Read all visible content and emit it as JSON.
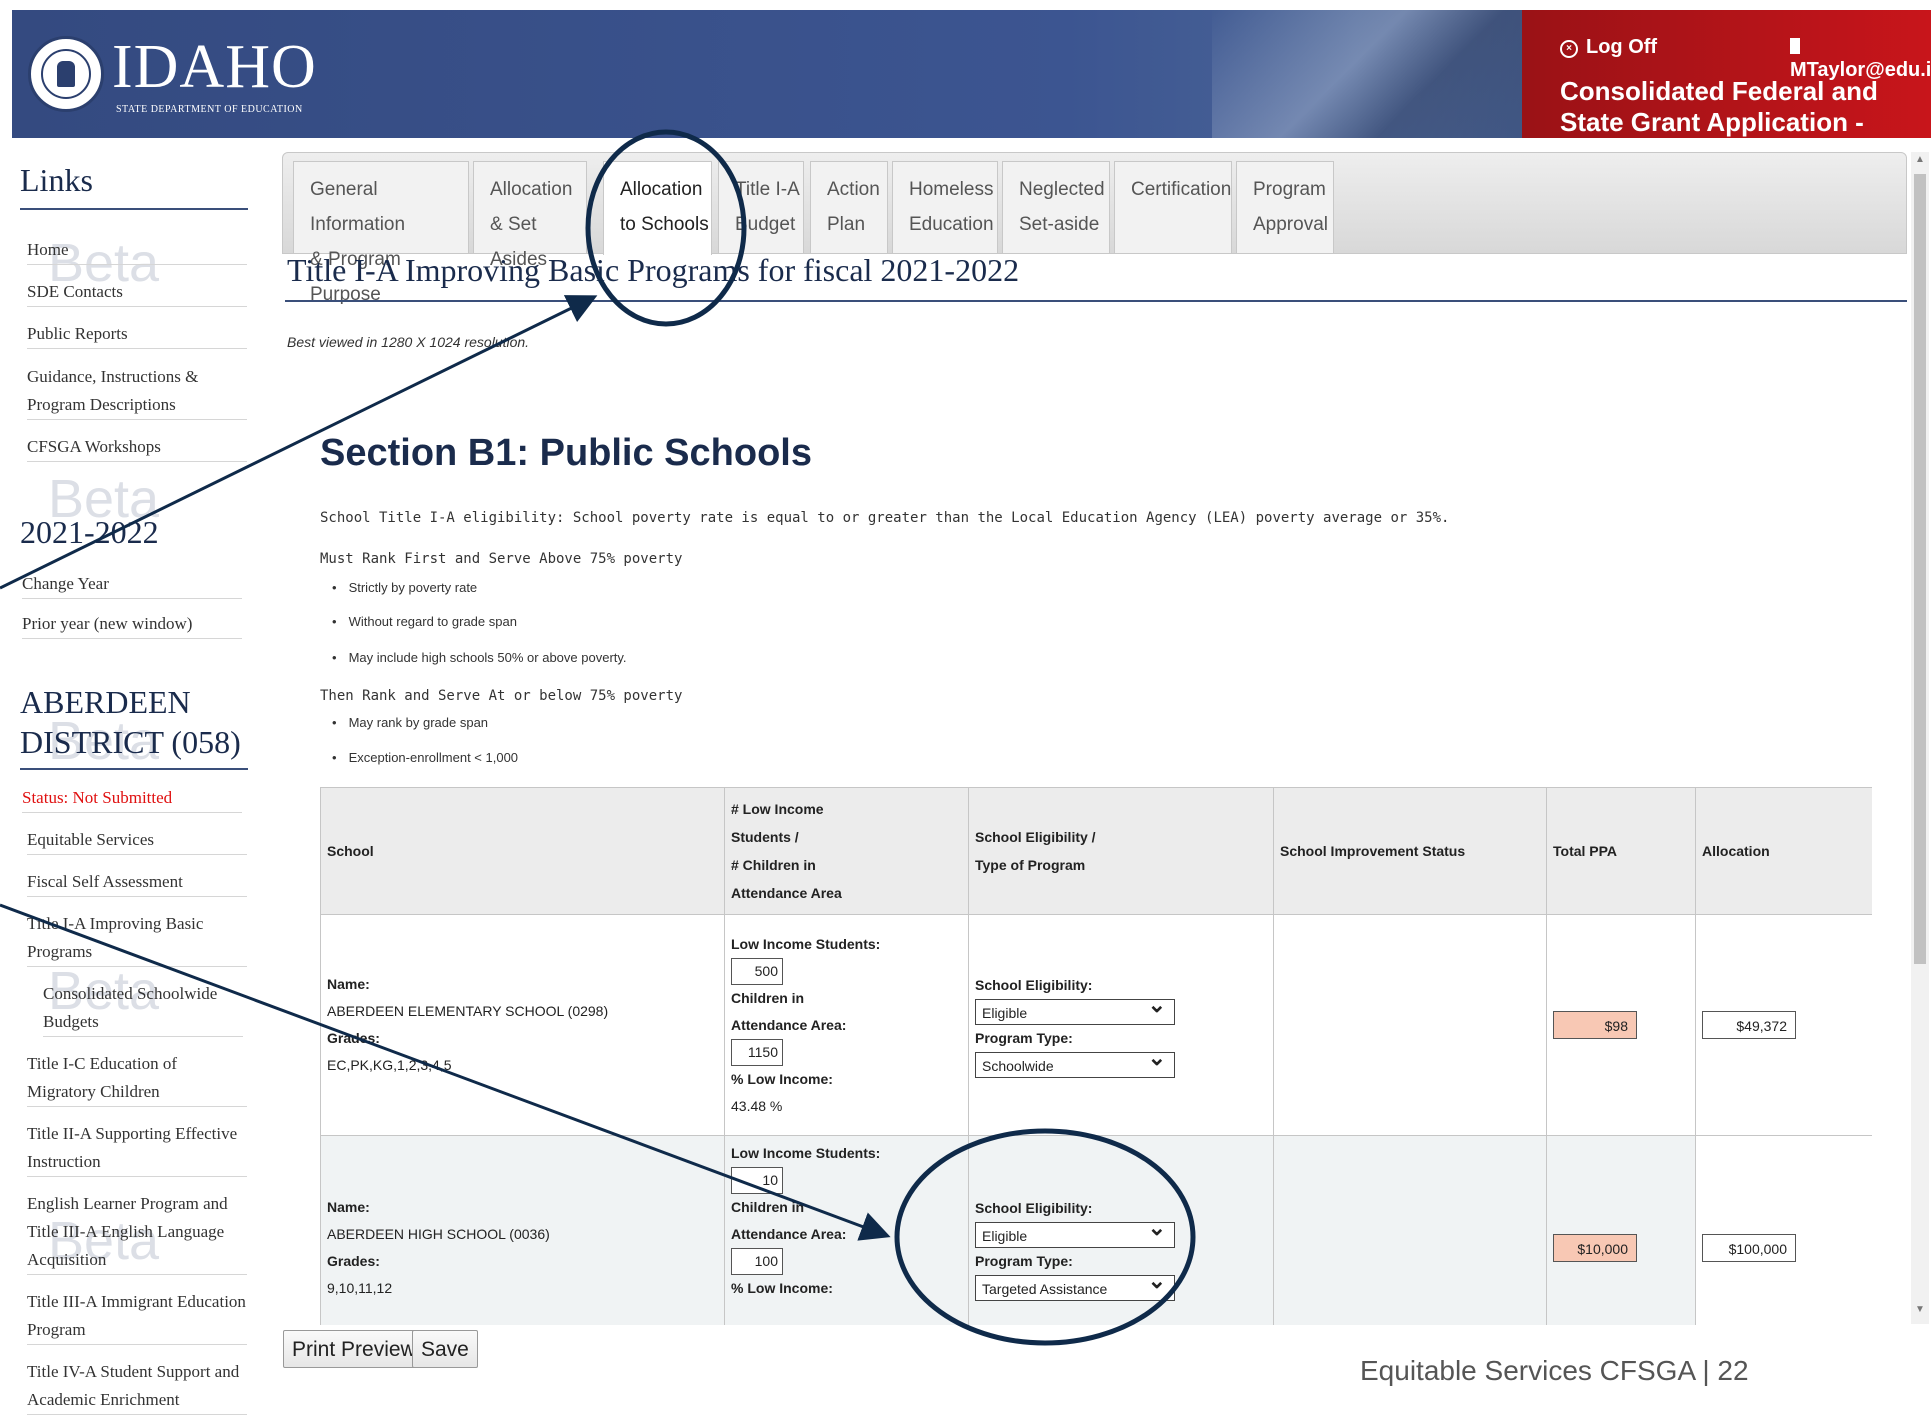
{
  "header": {
    "logo_text": "IDAHO",
    "logo_subtitle": "STATE DEPARTMENT OF EDUCATION",
    "logoff_label": "Log Off",
    "user_email": "MTaylor@edu.id",
    "app_title": "Consolidated Federal and State Grant Application - Beta"
  },
  "sidebar": {
    "links_heading": "Links",
    "links": [
      "Home",
      "SDE Contacts",
      "Public Reports",
      "Guidance, Instructions & Program Descriptions",
      "CFSGA Workshops"
    ],
    "year_heading": "2021-2022",
    "year_links": [
      "Change Year",
      "Prior year (new window)"
    ],
    "district_heading": "ABERDEEN DISTRICT (058)",
    "status": "Status: Not Submitted",
    "district_links": [
      "Equitable Services",
      "Fiscal Self Assessment",
      "Title I-A Improving Basic Programs",
      "Consolidated Schoolwide Budgets",
      "Title I-C Education of Migratory Children",
      "Title II-A Supporting Effective Instruction",
      "English Learner Program and Title III-A English Language Acquisition",
      "Title III-A Immigrant Education Program",
      "Title IV-A Student Support and Academic Enrichment"
    ],
    "watermark": "Beta"
  },
  "tabs": [
    {
      "line1": "General Information",
      "line2": "& Program Purpose"
    },
    {
      "line1": "Allocation",
      "line2": "& Set Asides"
    },
    {
      "line1": "Allocation",
      "line2": "to Schools"
    },
    {
      "line1": "Title I-A",
      "line2": "Budget"
    },
    {
      "line1": "Action",
      "line2": "Plan"
    },
    {
      "line1": "Homeless",
      "line2": "Education"
    },
    {
      "line1": "Neglected",
      "line2": "Set-aside"
    },
    {
      "line1": "Certification",
      "line2": ""
    },
    {
      "line1": "Program",
      "line2": "Approval"
    }
  ],
  "main": {
    "page_title": "Title I-A Improving Basic Programs for fiscal 2021-2022",
    "best_viewed": "Best viewed in 1280 X 1024 resolution.",
    "section_heading": "Section B1: Public Schools",
    "eligibility_text": "School Title I-A eligibility: School poverty rate is equal to or greater than the Local Education Agency (LEA) poverty average or 35%.",
    "rank_first": "Must Rank First and Serve Above 75% poverty",
    "rank_first_bullets": [
      "Strictly by poverty rate",
      "Without regard to grade span",
      "May include high schools 50% or above poverty."
    ],
    "rank_then": "Then Rank and Serve At or below 75% poverty",
    "rank_then_bullets": [
      "May rank by grade span",
      "Exception-enrollment < 1,000"
    ]
  },
  "table": {
    "headers": {
      "school": "School",
      "low_income_1": "# Low Income",
      "low_income_2": "Students /",
      "low_income_3": "# Children in",
      "low_income_4": "Attendance Area",
      "eligibility_1": "School Eligibility /",
      "eligibility_2": "Type of Program",
      "improvement": "School Improvement Status",
      "ppa": "Total PPA",
      "allocation": "Allocation"
    },
    "labels": {
      "name": "Name:",
      "grades": "Grades:",
      "low_income_students": "Low Income Students:",
      "children_in": "Children in",
      "attendance_area": "Attendance Area:",
      "pct_low_income": "% Low Income:",
      "school_eligibility": "School Eligibility:",
      "program_type": "Program Type:"
    },
    "rows": [
      {
        "name": "ABERDEEN ELEMENTARY SCHOOL (0298)",
        "grades": "EC,PK,KG,1,2,3,4,5",
        "low_income": "500",
        "children": "1150",
        "pct": "43.48 %",
        "eligibility": "Eligible",
        "program_type": "Schoolwide",
        "improvement": "",
        "ppa": "$98",
        "allocation": "$49,372"
      },
      {
        "name": "ABERDEEN HIGH SCHOOL (0036)",
        "grades": "9,10,11,12",
        "low_income": "10",
        "children": "100",
        "pct": "",
        "eligibility": "Eligible",
        "program_type": "Targeted Assistance",
        "improvement": "",
        "ppa": "$10,000",
        "allocation": "$100,000"
      }
    ]
  },
  "buttons": {
    "print_preview": "Print Preview",
    "save": "Save"
  },
  "footer": "Equitable Services CFSGA | 22",
  "colors": {
    "header_blue": "#3c5591",
    "header_red": "#c8151b",
    "ppa_fill": "#f8c8b4",
    "annotation": "#0f2a4a"
  }
}
